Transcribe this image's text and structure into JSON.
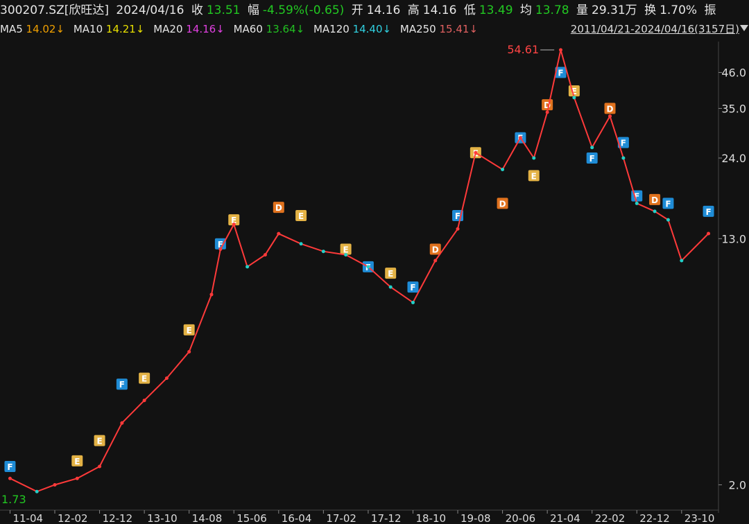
{
  "header": {
    "code": "300207.SZ[欣旺达]",
    "date": "2024/04/16",
    "close_label": "收",
    "close": "13.51",
    "change_label": "幅",
    "change": "-4.59%(-0.65)",
    "open_label": "开",
    "open": "14.16",
    "high_label": "高",
    "high": "14.16",
    "low_label": "低",
    "low": "13.49",
    "avg_label": "均",
    "avg": "13.78",
    "volume_label": "量",
    "volume": "29.31万",
    "turnover_label": "换",
    "turnover": "1.70%",
    "amplitude_label": "振"
  },
  "ma_row": [
    {
      "name": "MA5",
      "value": "14.02↓",
      "color": "#f0a000"
    },
    {
      "name": "MA10",
      "value": "14.21↓",
      "color": "#e8e000"
    },
    {
      "name": "MA20",
      "value": "14.16↓",
      "color": "#e040e0"
    },
    {
      "name": "MA60",
      "value": "13.64↓",
      "color": "#22c022"
    },
    {
      "name": "MA120",
      "value": "14.40↓",
      "color": "#30d0e0"
    },
    {
      "name": "MA250",
      "value": "15.41↓",
      "color": "#e06060"
    }
  ],
  "range_label": "2011/04/21-2024/04/16(3157日)",
  "colors": {
    "background": "#121212",
    "up": "#ff3a3a",
    "down": "#22d0c8",
    "axis_text": "#dcdcdc",
    "change_green": "#22c822",
    "badge_F": "#1f8cd6",
    "badge_E": "#e3b245",
    "badge_D": "#e0721e"
  },
  "chart_data": {
    "type": "line",
    "title": "",
    "xlabel": "",
    "ylabel": "",
    "y_scale": "log",
    "ylim": [
      1.73,
      54.61
    ],
    "y_ticks": [
      2.0,
      13.0,
      24.0,
      35.0,
      46.0
    ],
    "y_tick_labels": [
      "2.0",
      "13.0",
      "24.0",
      "35.0",
      "46.0"
    ],
    "x_tick_labels": [
      "11-04",
      "12-02",
      "12-12",
      "13-10",
      "14-08",
      "15-06",
      "16-04",
      "17-02",
      "17-12",
      "18-10",
      "19-08",
      "20-06",
      "21-04",
      "22-02",
      "22-12",
      "23-10"
    ],
    "max_point": {
      "x": "21-04",
      "value": 54.61,
      "label": "54.61"
    },
    "min_point": {
      "x": "11-04",
      "value": 1.73,
      "label": "1.73"
    },
    "series": [
      {
        "key": "close",
        "x": [
          "11-04",
          "11-10",
          "12-02",
          "12-07",
          "12-12",
          "13-05",
          "13-10",
          "14-03",
          "14-08",
          "15-01",
          "15-03",
          "15-06",
          "15-09",
          "16-01",
          "16-04",
          "16-09",
          "17-02",
          "17-07",
          "17-12",
          "18-05",
          "18-10",
          "19-03",
          "19-08",
          "19-12",
          "20-06",
          "20-10",
          "21-01",
          "21-04",
          "21-07",
          "21-10",
          "22-02",
          "22-06",
          "22-09",
          "22-12",
          "23-04",
          "23-07",
          "23-10",
          "24-04"
        ],
        "values": [
          2.1,
          1.9,
          2.0,
          2.1,
          2.3,
          3.2,
          3.8,
          4.5,
          5.5,
          8.5,
          12.0,
          14.5,
          10.5,
          11.5,
          13.5,
          12.5,
          11.8,
          11.5,
          10.5,
          9.0,
          8.0,
          11.0,
          14.0,
          25.0,
          22.0,
          28.0,
          24.0,
          34.0,
          54.61,
          38.0,
          26.0,
          33.0,
          24.0,
          17.0,
          16.0,
          15.0,
          11.0,
          13.51
        ]
      }
    ],
    "events": [
      {
        "x": "11-04",
        "type": "F",
        "value": 2.3
      },
      {
        "x": "12-07",
        "type": "E",
        "value": 2.4
      },
      {
        "x": "12-12",
        "type": "E",
        "value": 2.8
      },
      {
        "x": "13-05",
        "type": "F",
        "value": 4.3
      },
      {
        "x": "13-10",
        "type": "E",
        "value": 4.5
      },
      {
        "x": "14-08",
        "type": "E",
        "value": 6.5
      },
      {
        "x": "15-03",
        "type": "F",
        "value": 12.5
      },
      {
        "x": "15-06",
        "type": "E",
        "value": 15.0
      },
      {
        "x": "16-04",
        "type": "D",
        "value": 16.5
      },
      {
        "x": "16-09",
        "type": "E",
        "value": 15.5
      },
      {
        "x": "17-07",
        "type": "E",
        "value": 12.0
      },
      {
        "x": "17-12",
        "type": "F",
        "value": 10.5
      },
      {
        "x": "18-05",
        "type": "E",
        "value": 10.0
      },
      {
        "x": "18-10",
        "type": "F",
        "value": 9.0
      },
      {
        "x": "19-03",
        "type": "D",
        "value": 12.0
      },
      {
        "x": "19-08",
        "type": "F",
        "value": 15.5
      },
      {
        "x": "19-12",
        "type": "E",
        "value": 25.0
      },
      {
        "x": "20-06",
        "type": "D",
        "value": 17.0
      },
      {
        "x": "20-10",
        "type": "F",
        "value": 28.0
      },
      {
        "x": "21-01",
        "type": "E",
        "value": 21.0
      },
      {
        "x": "21-04",
        "type": "D",
        "value": 36.0
      },
      {
        "x": "21-07",
        "type": "F",
        "value": 46.0
      },
      {
        "x": "21-10",
        "type": "E",
        "value": 40.0
      },
      {
        "x": "22-02",
        "type": "F",
        "value": 24.0
      },
      {
        "x": "22-06",
        "type": "D",
        "value": 35.0
      },
      {
        "x": "22-09",
        "type": "F",
        "value": 27.0
      },
      {
        "x": "22-12",
        "type": "F",
        "value": 18.0
      },
      {
        "x": "23-04",
        "type": "D",
        "value": 17.5
      },
      {
        "x": "23-07",
        "type": "F",
        "value": 17.0
      },
      {
        "x": "24-04",
        "type": "F",
        "value": 16.0
      }
    ],
    "legend": "top-left",
    "grid": false
  }
}
